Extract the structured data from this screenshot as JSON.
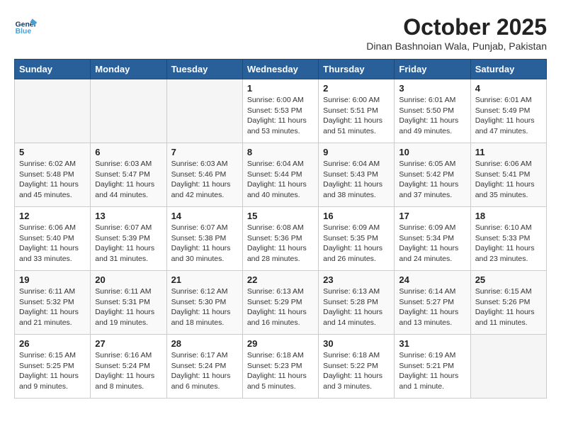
{
  "header": {
    "logo_line1": "General",
    "logo_line2": "Blue",
    "month": "October 2025",
    "location": "Dinan Bashnoian Wala, Punjab, Pakistan"
  },
  "weekdays": [
    "Sunday",
    "Monday",
    "Tuesday",
    "Wednesday",
    "Thursday",
    "Friday",
    "Saturday"
  ],
  "weeks": [
    [
      {
        "day": "",
        "info": ""
      },
      {
        "day": "",
        "info": ""
      },
      {
        "day": "",
        "info": ""
      },
      {
        "day": "1",
        "info": "Sunrise: 6:00 AM\nSunset: 5:53 PM\nDaylight: 11 hours and 53 minutes."
      },
      {
        "day": "2",
        "info": "Sunrise: 6:00 AM\nSunset: 5:51 PM\nDaylight: 11 hours and 51 minutes."
      },
      {
        "day": "3",
        "info": "Sunrise: 6:01 AM\nSunset: 5:50 PM\nDaylight: 11 hours and 49 minutes."
      },
      {
        "day": "4",
        "info": "Sunrise: 6:01 AM\nSunset: 5:49 PM\nDaylight: 11 hours and 47 minutes."
      }
    ],
    [
      {
        "day": "5",
        "info": "Sunrise: 6:02 AM\nSunset: 5:48 PM\nDaylight: 11 hours and 45 minutes."
      },
      {
        "day": "6",
        "info": "Sunrise: 6:03 AM\nSunset: 5:47 PM\nDaylight: 11 hours and 44 minutes."
      },
      {
        "day": "7",
        "info": "Sunrise: 6:03 AM\nSunset: 5:46 PM\nDaylight: 11 hours and 42 minutes."
      },
      {
        "day": "8",
        "info": "Sunrise: 6:04 AM\nSunset: 5:44 PM\nDaylight: 11 hours and 40 minutes."
      },
      {
        "day": "9",
        "info": "Sunrise: 6:04 AM\nSunset: 5:43 PM\nDaylight: 11 hours and 38 minutes."
      },
      {
        "day": "10",
        "info": "Sunrise: 6:05 AM\nSunset: 5:42 PM\nDaylight: 11 hours and 37 minutes."
      },
      {
        "day": "11",
        "info": "Sunrise: 6:06 AM\nSunset: 5:41 PM\nDaylight: 11 hours and 35 minutes."
      }
    ],
    [
      {
        "day": "12",
        "info": "Sunrise: 6:06 AM\nSunset: 5:40 PM\nDaylight: 11 hours and 33 minutes."
      },
      {
        "day": "13",
        "info": "Sunrise: 6:07 AM\nSunset: 5:39 PM\nDaylight: 11 hours and 31 minutes."
      },
      {
        "day": "14",
        "info": "Sunrise: 6:07 AM\nSunset: 5:38 PM\nDaylight: 11 hours and 30 minutes."
      },
      {
        "day": "15",
        "info": "Sunrise: 6:08 AM\nSunset: 5:36 PM\nDaylight: 11 hours and 28 minutes."
      },
      {
        "day": "16",
        "info": "Sunrise: 6:09 AM\nSunset: 5:35 PM\nDaylight: 11 hours and 26 minutes."
      },
      {
        "day": "17",
        "info": "Sunrise: 6:09 AM\nSunset: 5:34 PM\nDaylight: 11 hours and 24 minutes."
      },
      {
        "day": "18",
        "info": "Sunrise: 6:10 AM\nSunset: 5:33 PM\nDaylight: 11 hours and 23 minutes."
      }
    ],
    [
      {
        "day": "19",
        "info": "Sunrise: 6:11 AM\nSunset: 5:32 PM\nDaylight: 11 hours and 21 minutes."
      },
      {
        "day": "20",
        "info": "Sunrise: 6:11 AM\nSunset: 5:31 PM\nDaylight: 11 hours and 19 minutes."
      },
      {
        "day": "21",
        "info": "Sunrise: 6:12 AM\nSunset: 5:30 PM\nDaylight: 11 hours and 18 minutes."
      },
      {
        "day": "22",
        "info": "Sunrise: 6:13 AM\nSunset: 5:29 PM\nDaylight: 11 hours and 16 minutes."
      },
      {
        "day": "23",
        "info": "Sunrise: 6:13 AM\nSunset: 5:28 PM\nDaylight: 11 hours and 14 minutes."
      },
      {
        "day": "24",
        "info": "Sunrise: 6:14 AM\nSunset: 5:27 PM\nDaylight: 11 hours and 13 minutes."
      },
      {
        "day": "25",
        "info": "Sunrise: 6:15 AM\nSunset: 5:26 PM\nDaylight: 11 hours and 11 minutes."
      }
    ],
    [
      {
        "day": "26",
        "info": "Sunrise: 6:15 AM\nSunset: 5:25 PM\nDaylight: 11 hours and 9 minutes."
      },
      {
        "day": "27",
        "info": "Sunrise: 6:16 AM\nSunset: 5:24 PM\nDaylight: 11 hours and 8 minutes."
      },
      {
        "day": "28",
        "info": "Sunrise: 6:17 AM\nSunset: 5:24 PM\nDaylight: 11 hours and 6 minutes."
      },
      {
        "day": "29",
        "info": "Sunrise: 6:18 AM\nSunset: 5:23 PM\nDaylight: 11 hours and 5 minutes."
      },
      {
        "day": "30",
        "info": "Sunrise: 6:18 AM\nSunset: 5:22 PM\nDaylight: 11 hours and 3 minutes."
      },
      {
        "day": "31",
        "info": "Sunrise: 6:19 AM\nSunset: 5:21 PM\nDaylight: 11 hours and 1 minute."
      },
      {
        "day": "",
        "info": ""
      }
    ]
  ]
}
